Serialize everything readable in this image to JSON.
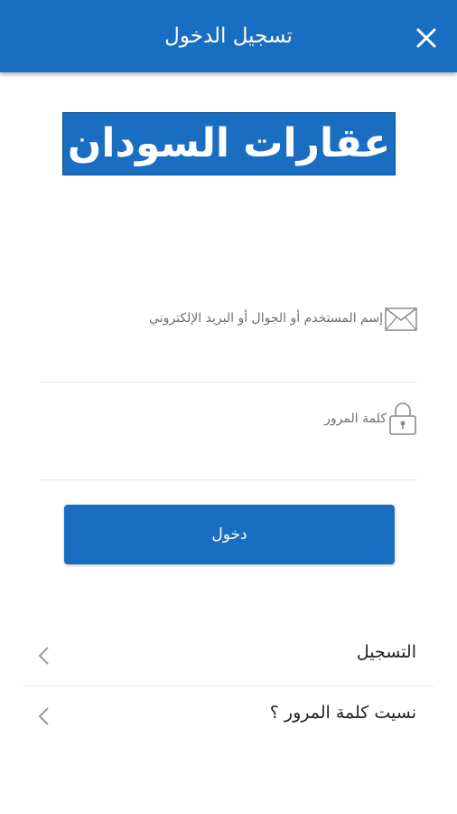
{
  "header": {
    "title": "تسجيل الدخول",
    "close_icon": "close-icon"
  },
  "logo": {
    "text": "عقارات السودان"
  },
  "form": {
    "username": {
      "placeholder": "إسم المستخدم أو الجوال أو البريد الإلكتروني",
      "icon": "envelope-icon"
    },
    "password": {
      "placeholder": "كلمة المرور",
      "icon": "lock-icon"
    },
    "login_label": "دخول"
  },
  "links": [
    {
      "label": "التسجيل",
      "icon": "chevron-left-icon"
    },
    {
      "label": "نسيت كلمة المرور ؟",
      "icon": "chevron-left-icon"
    }
  ],
  "colors": {
    "primary": "#1a6ec1",
    "text": "#222222",
    "muted": "#6f6f6f"
  }
}
